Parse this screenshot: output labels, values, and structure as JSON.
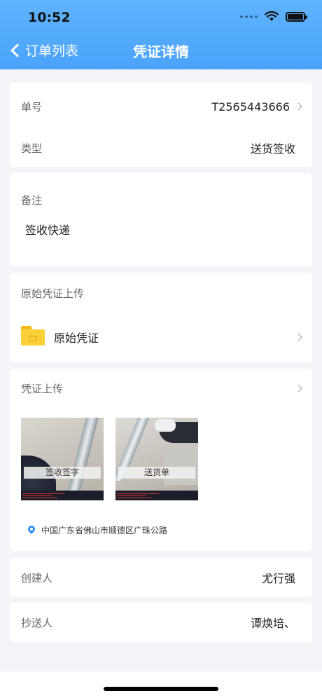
{
  "status_bar": {
    "time": "10:52"
  },
  "nav": {
    "back_label": "订单列表",
    "title": "凭证详情"
  },
  "info": {
    "order_no_label": "单号",
    "order_no_value": "T2565443666",
    "type_label": "类型",
    "type_value": "送货签收"
  },
  "remark": {
    "label": "备注",
    "text": "签收快递"
  },
  "original": {
    "section_title": "原始凭证上传",
    "folder_label": "原始凭证"
  },
  "upload": {
    "section_title": "凭证上传",
    "photos": [
      {
        "caption": "签收签字"
      },
      {
        "caption": "送货单"
      }
    ],
    "location": "中国广东省佛山市顺德区广珠公路"
  },
  "creator": {
    "label": "创建人",
    "value": "尤行强"
  },
  "cc": {
    "label": "抄送人",
    "value": "谭焕培、"
  },
  "icons": {
    "back": "chevron-left-icon",
    "chevron": "chevron-right-icon",
    "folder": "folder-icon",
    "location": "location-pin-icon",
    "signal": "signal-icon",
    "wifi": "wifi-icon",
    "battery": "battery-icon"
  },
  "colors": {
    "header": "#4aa3fb",
    "folder": "#fcd03a",
    "pin": "#2f8df2"
  }
}
